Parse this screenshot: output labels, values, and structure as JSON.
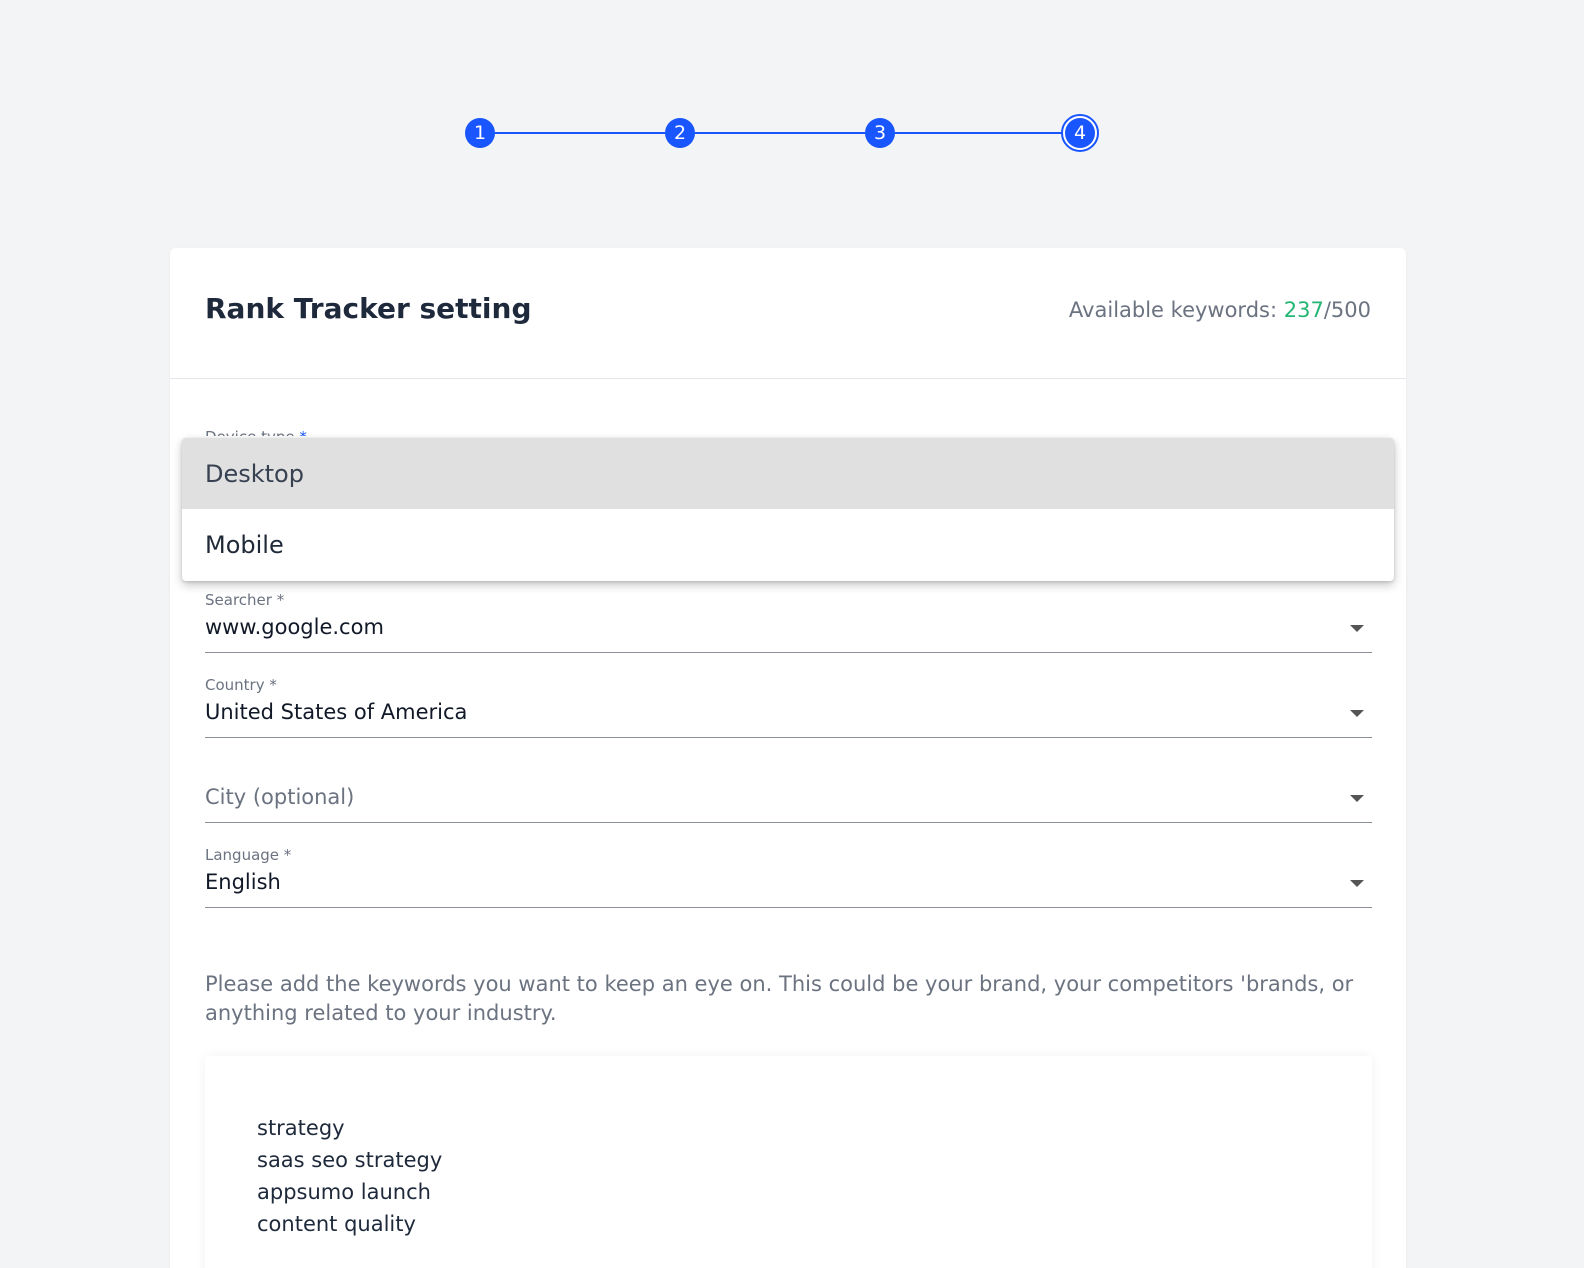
{
  "stepper": {
    "steps": [
      "1",
      "2",
      "3",
      "4"
    ],
    "current_step": "4"
  },
  "card": {
    "title": "Rank Tracker setting",
    "keywords_label": "Available keywords: ",
    "keywords_used": "237",
    "keywords_separator": "/",
    "keywords_total": "500"
  },
  "device": {
    "label": "Device type",
    "required_mark": "*",
    "options": [
      "Desktop",
      "Mobile"
    ],
    "highlighted": "Desktop"
  },
  "searcher": {
    "label": "Searcher *",
    "value": "www.google.com"
  },
  "country": {
    "label": "Country *",
    "value": "United States of America"
  },
  "city": {
    "placeholder": "City (optional)"
  },
  "language": {
    "label": "Language *",
    "value": "English"
  },
  "helper_text": "Please add the keywords you want to keep an eye on. This could be your brand, your competitors 'brands, or anything related to your industry.",
  "keywords": [
    "strategy",
    "saas seo strategy",
    "appsumo launch",
    "content quality"
  ],
  "colors": {
    "accent": "#1a56ff",
    "success": "#22b573",
    "background": "#f3f4f6",
    "highlight": "#e0e0e0"
  }
}
